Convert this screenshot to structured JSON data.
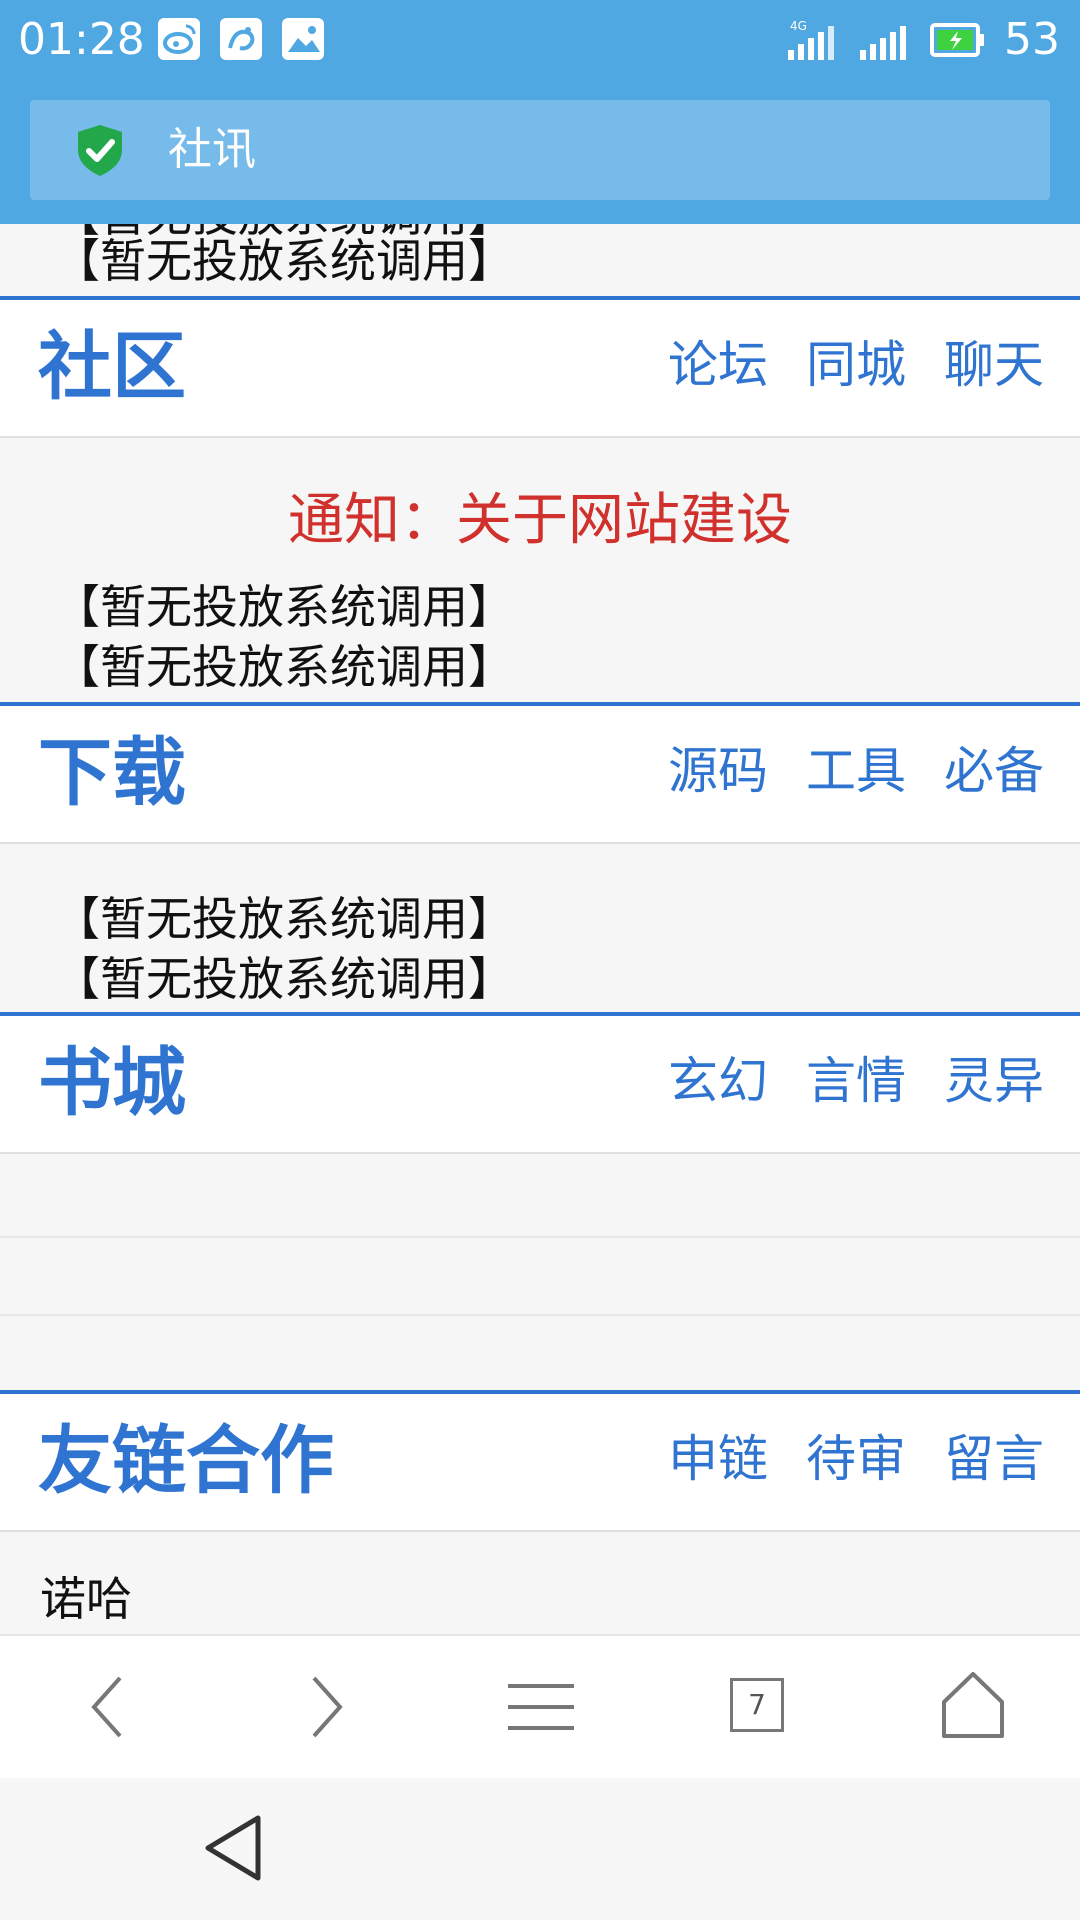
{
  "status_bar": {
    "time": "01:28",
    "app_icons": [
      "weibo-icon",
      "uc-browser-icon",
      "gallery-icon"
    ],
    "network": "4G",
    "battery": "53",
    "colors": {
      "background": "#4fa8e2"
    }
  },
  "url_bar": {
    "security_icon": "shield-check-icon",
    "title": "社讯"
  },
  "content": {
    "top_ad_lines": [
      "【暂无投放系统调用】",
      "【暂无投放系统调用】"
    ],
    "sections": [
      {
        "title": "社区",
        "links": [
          "论坛",
          "同城",
          "聊天"
        ],
        "notice": "通知：关于网站建设",
        "ad_lines": [
          "【暂无投放系统调用】",
          "【暂无投放系统调用】"
        ]
      },
      {
        "title": "下载",
        "links": [
          "源码",
          "工具",
          "必备"
        ],
        "ad_lines": [
          "【暂无投放系统调用】",
          "【暂无投放系统调用】"
        ]
      },
      {
        "title": "书城",
        "links": [
          "玄幻",
          "言情",
          "灵异"
        ]
      },
      {
        "title": "友链合作",
        "links": [
          "申链",
          "待审",
          "留言"
        ],
        "items": [
          "诺哈"
        ]
      }
    ],
    "colors": {
      "accent": "#2f74d0",
      "notice": "#d0312d"
    }
  },
  "toolbar": {
    "buttons": [
      "back-icon",
      "forward-icon",
      "menu-icon",
      "tabs-icon",
      "home-icon"
    ],
    "tab_count": "7"
  },
  "nav_bar": {
    "buttons": [
      "nav-back-icon"
    ]
  }
}
